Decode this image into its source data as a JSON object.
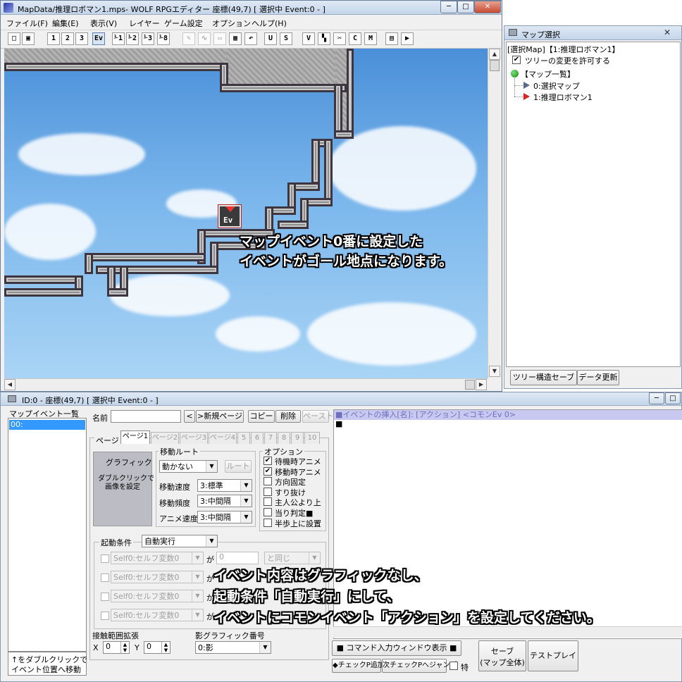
{
  "main_window": {
    "title": "MapData/推理ロボマン1.mps- WOLF RPGエディター 座標(49,7) [ 選択中 Event:0 - ]",
    "controls": {
      "minimize": "─",
      "maximize": "□",
      "close": "✕"
    }
  },
  "menu": [
    "ファイル(F)",
    "編集(E)",
    "表示(V)",
    "レイヤー",
    "ゲーム設定",
    "オプション",
    "ヘルプ(H)"
  ],
  "toolbar": {
    "buttons": [
      {
        "name": "new-icon",
        "label": "□"
      },
      {
        "name": "save-icon",
        "label": "▣"
      },
      {
        "name": "layer-1",
        "label": "1"
      },
      {
        "name": "layer-2",
        "label": "2"
      },
      {
        "name": "layer-3",
        "label": "3"
      },
      {
        "name": "event-layer",
        "label": "Ev"
      },
      {
        "name": "zoom-1",
        "label": "⅟1"
      },
      {
        "name": "zoom-2",
        "label": "⅟2"
      },
      {
        "name": "zoom-3",
        "label": "⅟3"
      },
      {
        "name": "zoom-4",
        "label": "⅟8"
      },
      {
        "name": "pen-icon",
        "label": "✎"
      },
      {
        "name": "line-icon",
        "label": "∿"
      },
      {
        "name": "rect-icon",
        "label": "▭"
      },
      {
        "name": "fill-icon",
        "label": "▦"
      },
      {
        "name": "undo-icon",
        "label": "↶"
      },
      {
        "name": "database-user-icon",
        "label": "U"
      },
      {
        "name": "database-system-icon",
        "label": "S"
      },
      {
        "name": "database-variable-icon",
        "label": "V"
      },
      {
        "name": "map-tree-icon",
        "label": "▚"
      },
      {
        "name": "tool-icon",
        "label": "✂"
      },
      {
        "name": "common-event-icon",
        "label": "C"
      },
      {
        "name": "map-settings-icon",
        "label": "M"
      },
      {
        "name": "script-icon",
        "label": "▤"
      },
      {
        "name": "play-icon",
        "label": "▶"
      }
    ]
  },
  "map": {
    "event_label": "Ev",
    "overlay_top": [
      "マップイベント0番に設定した",
      "イベントがゴール地点になります。"
    ]
  },
  "map_select_window": {
    "title": "マップ選択",
    "close": "✕",
    "selected_line": "[選択Map]【1:推理ロボマン1】",
    "allow_tree_change_label": "ツリーの変更を許可する",
    "allow_tree_change_checked": true,
    "tree_root": "【マップ一覧】",
    "tree_items": [
      "0:選択マップ",
      "1:推理ロボマン1"
    ],
    "buttons": {
      "save_tree": "ツリー構造セーブ",
      "update_data": "データ更新"
    }
  },
  "event_window": {
    "title": "ID:0 -  座標(49,7) [ 選択中 Event:0 - ]",
    "controls": {
      "minimize": "─",
      "maximize": "□"
    },
    "event_list_title": "マップイベント一覧",
    "event_list_items": [
      "00:"
    ],
    "event_list_hint": [
      "↑をダブルクリックで",
      "イベント位置へ移動"
    ],
    "name_label": "名前",
    "name_value": "",
    "prev_page_button": "<",
    "new_page_button": ">新規ページ",
    "copy_button": "コピー",
    "delete_button": "削除",
    "paste_button": "ペースト",
    "page_label": "ページ",
    "tabs": [
      "ページ1",
      "ページ2",
      "ページ3",
      "ページ4",
      "5",
      "6",
      "7",
      "8",
      "9",
      "10"
    ],
    "graphic": {
      "title": "グラフィック",
      "hint": [
        "ダブルクリックで",
        "画像を設定"
      ]
    },
    "move_route": {
      "title": "移動ルート",
      "type_value": "動かない",
      "route_button": "ルート",
      "speed_label": "移動速度",
      "speed_value": "3:標準",
      "frequency_label": "移動頻度",
      "frequency_value": "3:中間隔",
      "anim_label": "アニメ速度",
      "anim_value": "3:中間隔"
    },
    "options": {
      "title": "オプション",
      "items": [
        {
          "label": "待機時アニメ",
          "checked": true
        },
        {
          "label": "移動時アニメ",
          "checked": true
        },
        {
          "label": "方向固定",
          "checked": false
        },
        {
          "label": "すり抜け",
          "checked": false
        },
        {
          "label": "主人公より上",
          "checked": false
        },
        {
          "label": "当り判定■",
          "checked": false
        },
        {
          "label": "半歩上に設置",
          "checked": false
        }
      ]
    },
    "start_condition": {
      "title": "起動条件",
      "value": "自動実行",
      "rows": [
        {
          "var": "Self0:セルフ変数0",
          "ga": "が",
          "num": "0",
          "op": "と同じ"
        },
        {
          "var": "Self0:セルフ変数0",
          "ga": "が"
        },
        {
          "var": "Self0:セルフ変数0",
          "ga": "が"
        },
        {
          "var": "Self0:セルフ変数0",
          "ga": "が"
        }
      ]
    },
    "contact_range": {
      "title": "接触範囲拡張",
      "x_label": "X",
      "x_value": "0",
      "y_label": "Y",
      "y_value": "0"
    },
    "shadow": {
      "title": "影グラフィック番号",
      "value": "0:影"
    },
    "command_header": "■イベントの挿入[名]: [アクション] <コモンEv 0>",
    "command_line": "■",
    "command_window_button": "■  コマンド入力ウィンドウ表示  ■",
    "save_button": [
      "セーブ",
      "(マップ全体)"
    ],
    "testplay_button": "テストプレイ",
    "checkpoint_add_button": "◆チェックP追加",
    "next_checkpoint_button": "次チェックPへジャンプ",
    "special_label": "特",
    "overlay_bottom": [
      "イベント内容はグラフィックなし、",
      "起動条件「自動実行」にして、",
      "イベントにコモンイベント「アクション」を設定してください。"
    ]
  },
  "colors": {
    "titlebar": "#c4d5ea",
    "sky_top": "#4a8fd8",
    "sky_bottom": "#a9d4f5",
    "selection": "#3399ff",
    "command_header_bg": "#c8c8f0"
  }
}
